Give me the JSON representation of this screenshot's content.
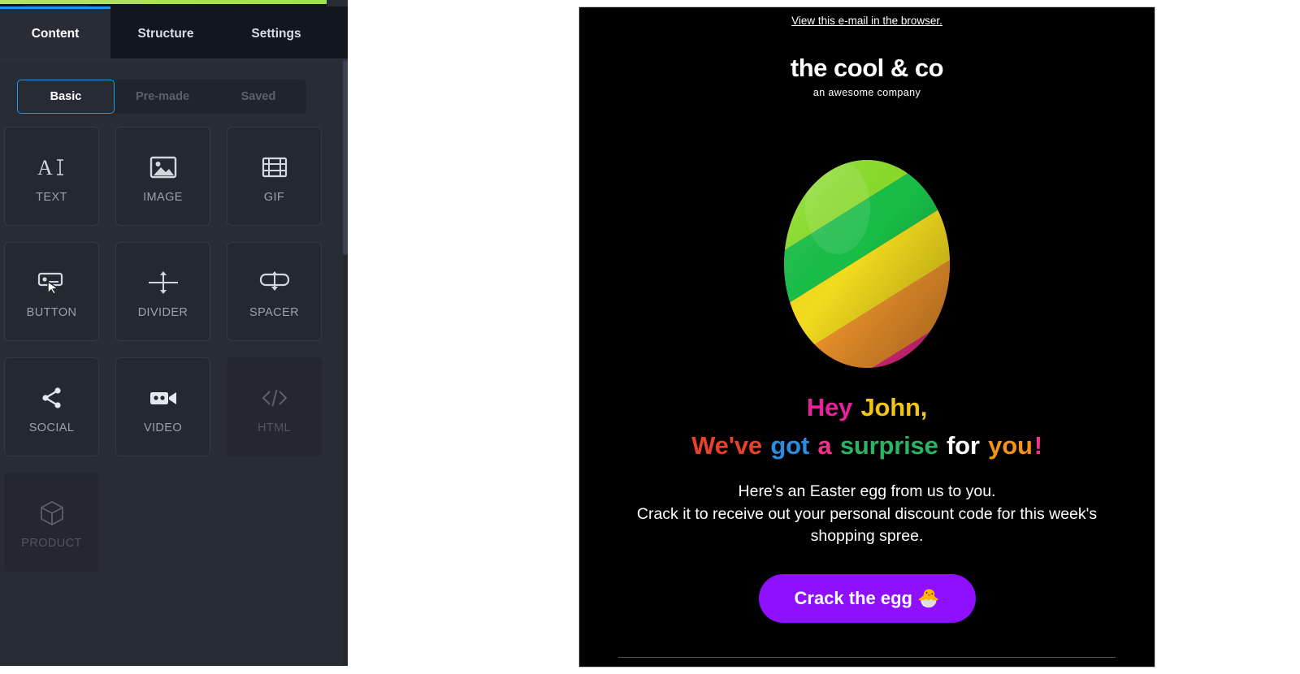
{
  "editor": {
    "progress_bar": {
      "name": "upload-progress",
      "color": "#a9e05f",
      "percent": 100
    },
    "tabs": [
      {
        "label": "Content",
        "active": true
      },
      {
        "label": "Structure",
        "active": false
      },
      {
        "label": "Settings",
        "active": false
      }
    ],
    "segmented": [
      {
        "label": "Basic",
        "active": true,
        "disabled": false
      },
      {
        "label": "Pre-made",
        "active": false,
        "disabled": true
      },
      {
        "label": "Saved",
        "active": false,
        "disabled": true
      }
    ],
    "blocks": [
      {
        "label": "TEXT",
        "icon": "text-icon",
        "disabled": false
      },
      {
        "label": "IMAGE",
        "icon": "image-icon",
        "disabled": false
      },
      {
        "label": "GIF",
        "icon": "gif-icon",
        "disabled": false
      },
      {
        "label": "BUTTON",
        "icon": "button-icon",
        "disabled": false
      },
      {
        "label": "DIVIDER",
        "icon": "divider-icon",
        "disabled": false
      },
      {
        "label": "SPACER",
        "icon": "spacer-icon",
        "disabled": false
      },
      {
        "label": "SOCIAL",
        "icon": "social-share-icon",
        "disabled": false
      },
      {
        "label": "VIDEO",
        "icon": "video-camera-icon",
        "disabled": false
      },
      {
        "label": "HTML",
        "icon": "code-icon",
        "disabled": true
      },
      {
        "label": "PRODUCT",
        "icon": "cube-icon",
        "disabled": true
      }
    ],
    "accent_color": "#2196f3",
    "sidebar_bg": "#282c34",
    "tabbar_bg": "#11161f"
  },
  "email": {
    "background_color": "#000000",
    "preheader": "View this e-mail in the browser.",
    "brand_name": "the cool & co",
    "tagline": "an awesome company",
    "hero_image": {
      "name": "easter-egg-image",
      "alt": "rainbow striped easter egg",
      "stripe_colors": [
        "#ff2d8f",
        "#ff9d2e",
        "#ffe61f",
        "#8ee62a",
        "#19c74a",
        "#28f0c0",
        "#35e8ff"
      ]
    },
    "headline_line1": [
      {
        "text": "Hey ",
        "color": "#e8219c"
      },
      {
        "text": "John,",
        "color": "#f0c419"
      }
    ],
    "headline_line2": [
      {
        "text": "We've ",
        "color": "#e8402c"
      },
      {
        "text": "got ",
        "color": "#2d8ce0"
      },
      {
        "text": "a ",
        "color": "#f2338c"
      },
      {
        "text": "surprise ",
        "color": "#2bb463"
      },
      {
        "text": "for ",
        "color": "#ffffff"
      },
      {
        "text": "you",
        "color": "#f59218"
      },
      {
        "text": "!",
        "color": "#f2338c"
      }
    ],
    "body_line1": "Here's an Easter egg from us to you.",
    "body_line2": "Crack it to receive out your personal discount code for this week's shopping spree.",
    "cta_label": "Crack the egg 🐣",
    "cta_color": "#8f0fff"
  }
}
